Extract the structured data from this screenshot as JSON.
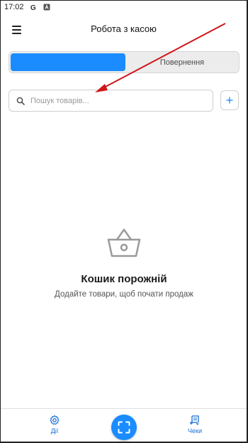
{
  "status_bar": {
    "time": "17:02",
    "icons": [
      "google-icon",
      "notification-icon"
    ]
  },
  "app_bar": {
    "title": "Робота з касою",
    "menu_icon": "hamburger-menu-icon"
  },
  "segmented_control": {
    "tabs": [
      {
        "label": "",
        "active": true
      },
      {
        "label": "Повернення",
        "active": false
      }
    ]
  },
  "search": {
    "placeholder": "Пошук товарів...",
    "value": ""
  },
  "add_button": {
    "icon": "plus-icon"
  },
  "empty_state": {
    "icon": "basket-icon",
    "title": "Кошик порожній",
    "subtitle": "Додайте товари, щоб почати продаж"
  },
  "bottom_nav": {
    "items": [
      {
        "label": "Дії",
        "icon": "gear-icon"
      },
      {
        "label": "Чеки",
        "icon": "receipt-icon"
      }
    ],
    "scan_icon": "scan-icon"
  },
  "colors": {
    "accent": "#1a8cff",
    "nav_label": "#1a6fd6",
    "annotation_arrow": "#d0161b"
  }
}
